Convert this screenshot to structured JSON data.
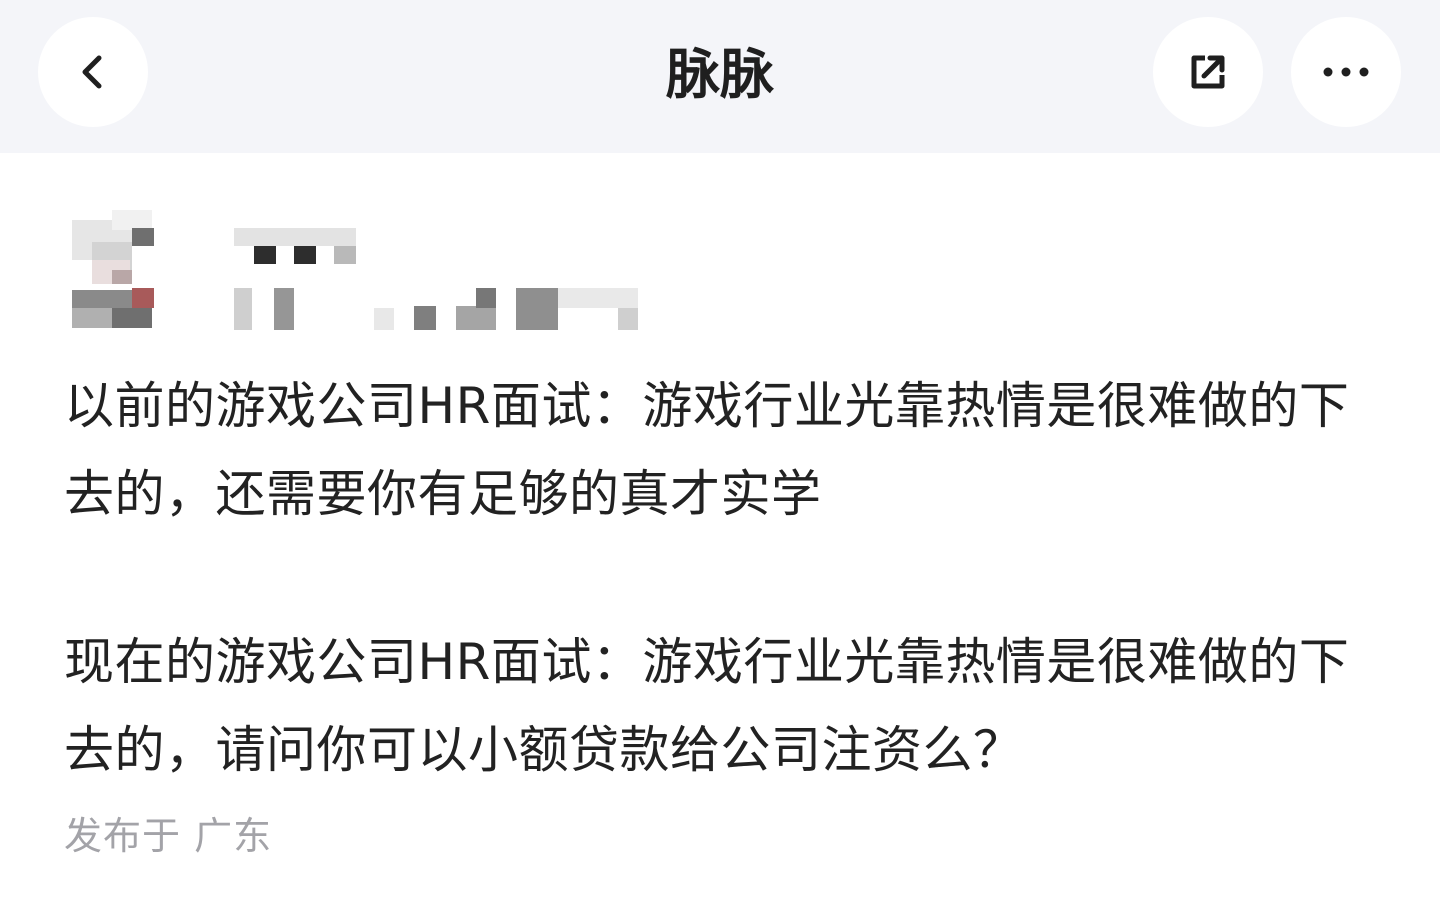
{
  "header": {
    "title": "脉脉",
    "back_icon": "chevron-left-icon",
    "share_icon": "share-external-icon",
    "more_icon": "more-dots-icon"
  },
  "author": {
    "avatar": "avatar-pixelated",
    "name": "",
    "meta": ""
  },
  "post": {
    "paragraphs": [
      "以前的游戏公司HR面试：游戏行业光靠热情是很难做的下去的，还需要你有足够的真才实学",
      "现在的游戏公司HR面试：游戏行业光靠热情是很难做的下去的，请问你可以小额贷款给公司注资么？"
    ],
    "location": "发布于 广东"
  },
  "colors": {
    "header_bg": "#f4f5f9",
    "text": "#222222",
    "muted": "#a3a3a8"
  }
}
